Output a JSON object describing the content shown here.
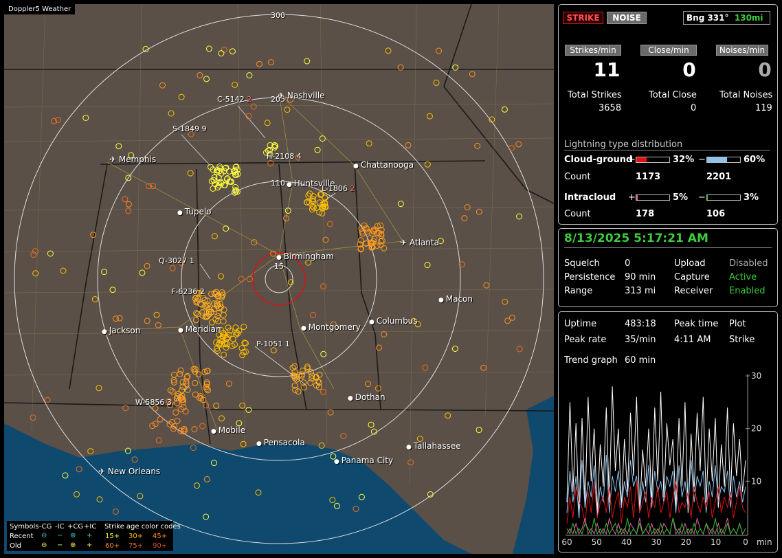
{
  "app": {
    "brand": "Doppler5 Weather"
  },
  "map": {
    "range_labels": [
      "300",
      "205",
      "110",
      "15"
    ],
    "cities": [
      {
        "name": "Nashville",
        "airport": true
      },
      {
        "name": "Memphis",
        "airport": true
      },
      {
        "name": "Chattanooga",
        "airport": false
      },
      {
        "name": "Huntsville",
        "airport": false
      },
      {
        "name": "Tupelo",
        "airport": false
      },
      {
        "name": "Atlanta",
        "airport": true
      },
      {
        "name": "Birmingham",
        "airport": false
      },
      {
        "name": "Macon",
        "airport": false
      },
      {
        "name": "Jackson",
        "airport": false
      },
      {
        "name": "Meridian",
        "airport": false
      },
      {
        "name": "Montgomery",
        "airport": false
      },
      {
        "name": "Columbus",
        "airport": false
      },
      {
        "name": "Dothan",
        "airport": false
      },
      {
        "name": "Mobile",
        "airport": false
      },
      {
        "name": "Pensacola",
        "airport": false
      },
      {
        "name": "Tallahassee",
        "airport": false
      },
      {
        "name": "Panama City",
        "airport": false
      },
      {
        "name": "New Orleans",
        "airport": true
      }
    ],
    "storms": [
      "C-5142",
      "S-1849",
      "H-2108",
      "L-1806",
      "Q-3027",
      "F-6236",
      "P-1051",
      "W-5856"
    ],
    "storm_suffixes": [
      "2",
      "9",
      "4",
      "2",
      "1",
      "2",
      "1",
      "3"
    ]
  },
  "legend": {
    "symbols": "Symbols",
    "cols": [
      "-CG",
      "-IC",
      "+CG",
      "+IC"
    ],
    "age_title": "Strike age color codes",
    "recent": "Recent",
    "old": "Old",
    "recent_ages": [
      "15+",
      "30+",
      "45+"
    ],
    "old_ages": [
      "60+",
      "75+",
      "90+"
    ]
  },
  "top": {
    "strike": "STRIKE",
    "noise": "NOISE",
    "bearing": "Bng 331°",
    "range": "130mi"
  },
  "rates": {
    "strikes_label": "Strikes/min",
    "close_label": "Close/min",
    "noises_label": "Noises/min",
    "strikes": "11",
    "close": "0",
    "noises": "0",
    "total_strikes_label": "Total Strikes",
    "total_close_label": "Total Close",
    "total_noises_label": "Total Noises",
    "total_strikes": "3658",
    "total_close": "0",
    "total_noises": "119"
  },
  "distribution": {
    "title": "Lightning type distribution",
    "cg_label": "Cloud-ground",
    "ic_label": "Intracloud",
    "plus": "+",
    "minus": "−",
    "count_label": "Count",
    "cg_pos_pct": "32%",
    "cg_neg_pct": "60%",
    "ic_pos_pct": "5%",
    "ic_neg_pct": "3%",
    "cg_pos_count": "1173",
    "cg_neg_count": "2201",
    "ic_pos_count": "178",
    "ic_neg_count": "106",
    "cg_pos_frac": 0.32,
    "cg_neg_frac": 0.6,
    "ic_pos_frac": 0.05,
    "ic_neg_frac": 0.03,
    "colors": {
      "cg_pos": "#e01010",
      "cg_neg": "#8cc4f0",
      "ic_pos": "#e060a0",
      "ic_neg": "#30c030"
    }
  },
  "status": {
    "datetime": "8/13/2025 5:17:21 AM",
    "squelch_label": "Squelch",
    "squelch": "0",
    "persistence_label": "Persistence",
    "persistence": "90 min",
    "range_label": "Range",
    "range": "313 mi",
    "upload_label": "Upload",
    "upload": "Disabled",
    "capture_label": "Capture",
    "capture": "Active",
    "receiver_label": "Receiver",
    "receiver": "Enabled"
  },
  "stats": {
    "uptime_label": "Uptime",
    "uptime": "483:18",
    "peak_time_label": "Peak time",
    "peak_time": "4:11 AM",
    "plot_label": "Plot",
    "plot": "Strike",
    "peak_rate_label": "Peak rate",
    "peak_rate": "35/min",
    "trend_label": "Trend graph",
    "trend": "60 min"
  },
  "chart_data": {
    "type": "line",
    "x_ticks": [
      "60",
      "50",
      "40",
      "30",
      "20",
      "10",
      "0"
    ],
    "x_unit": "min",
    "y_ticks": [
      "30",
      "20",
      "10"
    ],
    "ylim": [
      0,
      30
    ],
    "series": [
      {
        "color": "#ffffff",
        "values": [
          6,
          25,
          8,
          21,
          3,
          22,
          5,
          26,
          10,
          20,
          4,
          17,
          9,
          24,
          6,
          28,
          12,
          20,
          5,
          18,
          8,
          23,
          11,
          26,
          4,
          16,
          9,
          20,
          6,
          24,
          10,
          27,
          7,
          21,
          13,
          18,
          5,
          22,
          9,
          25,
          4,
          19,
          8,
          23,
          12,
          26,
          6,
          20,
          10,
          22,
          5,
          17,
          9,
          24,
          7,
          21,
          11,
          18,
          8,
          14
        ]
      },
      {
        "color": "#8cc4f0",
        "values": [
          4,
          12,
          6,
          11,
          3,
          14,
          5,
          10,
          7,
          13,
          3,
          9,
          6,
          15,
          4,
          11,
          8,
          12,
          5,
          10,
          7,
          14,
          9,
          11,
          4,
          10,
          6,
          13,
          5,
          12,
          8,
          10,
          6,
          11,
          9,
          12,
          4,
          13,
          7,
          10,
          5,
          14,
          6,
          11,
          9,
          12,
          4,
          10,
          7,
          13,
          6,
          9,
          8,
          12,
          5,
          11,
          7,
          10,
          6,
          9
        ]
      },
      {
        "color": "#e01010",
        "values": [
          2,
          7,
          3,
          9,
          6,
          5,
          2,
          8,
          4,
          10,
          3,
          6,
          7,
          4,
          9,
          3,
          6,
          8,
          2,
          7,
          5,
          9,
          3,
          10,
          4,
          6,
          8,
          3,
          7,
          5,
          9,
          4,
          6,
          8,
          3,
          7,
          10,
          4,
          6,
          5,
          8,
          3,
          9,
          6,
          4,
          7,
          5,
          8,
          3,
          6,
          9,
          4,
          7,
          5,
          8,
          3,
          6,
          9,
          5,
          4
        ]
      },
      {
        "color": "#e060a0",
        "values": [
          0,
          1,
          0,
          2,
          0,
          1,
          3,
          0,
          1,
          0,
          2,
          0,
          1,
          0,
          3,
          1,
          0,
          2,
          0,
          1,
          0,
          2,
          1,
          0,
          3,
          0,
          1,
          0,
          2,
          0,
          1,
          0,
          2,
          1,
          0,
          3,
          0,
          1,
          0,
          2,
          0,
          1,
          0,
          3,
          1,
          0,
          2,
          0,
          1,
          0,
          2,
          0,
          1,
          3,
          0,
          1,
          0,
          2,
          0,
          1
        ]
      },
      {
        "color": "#30c030",
        "values": [
          1,
          0,
          2,
          0,
          1,
          0,
          2,
          1,
          0,
          3,
          0,
          1,
          0,
          2,
          0,
          1,
          2,
          0,
          1,
          0,
          3,
          0,
          1,
          0,
          2,
          0,
          1,
          2,
          0,
          1,
          0,
          2,
          0,
          1,
          0,
          3,
          1,
          0,
          2,
          0,
          1,
          0,
          2,
          0,
          1,
          0,
          2,
          1,
          0,
          3,
          0,
          1,
          0,
          2,
          0,
          1,
          0,
          2,
          0,
          1
        ]
      }
    ]
  }
}
